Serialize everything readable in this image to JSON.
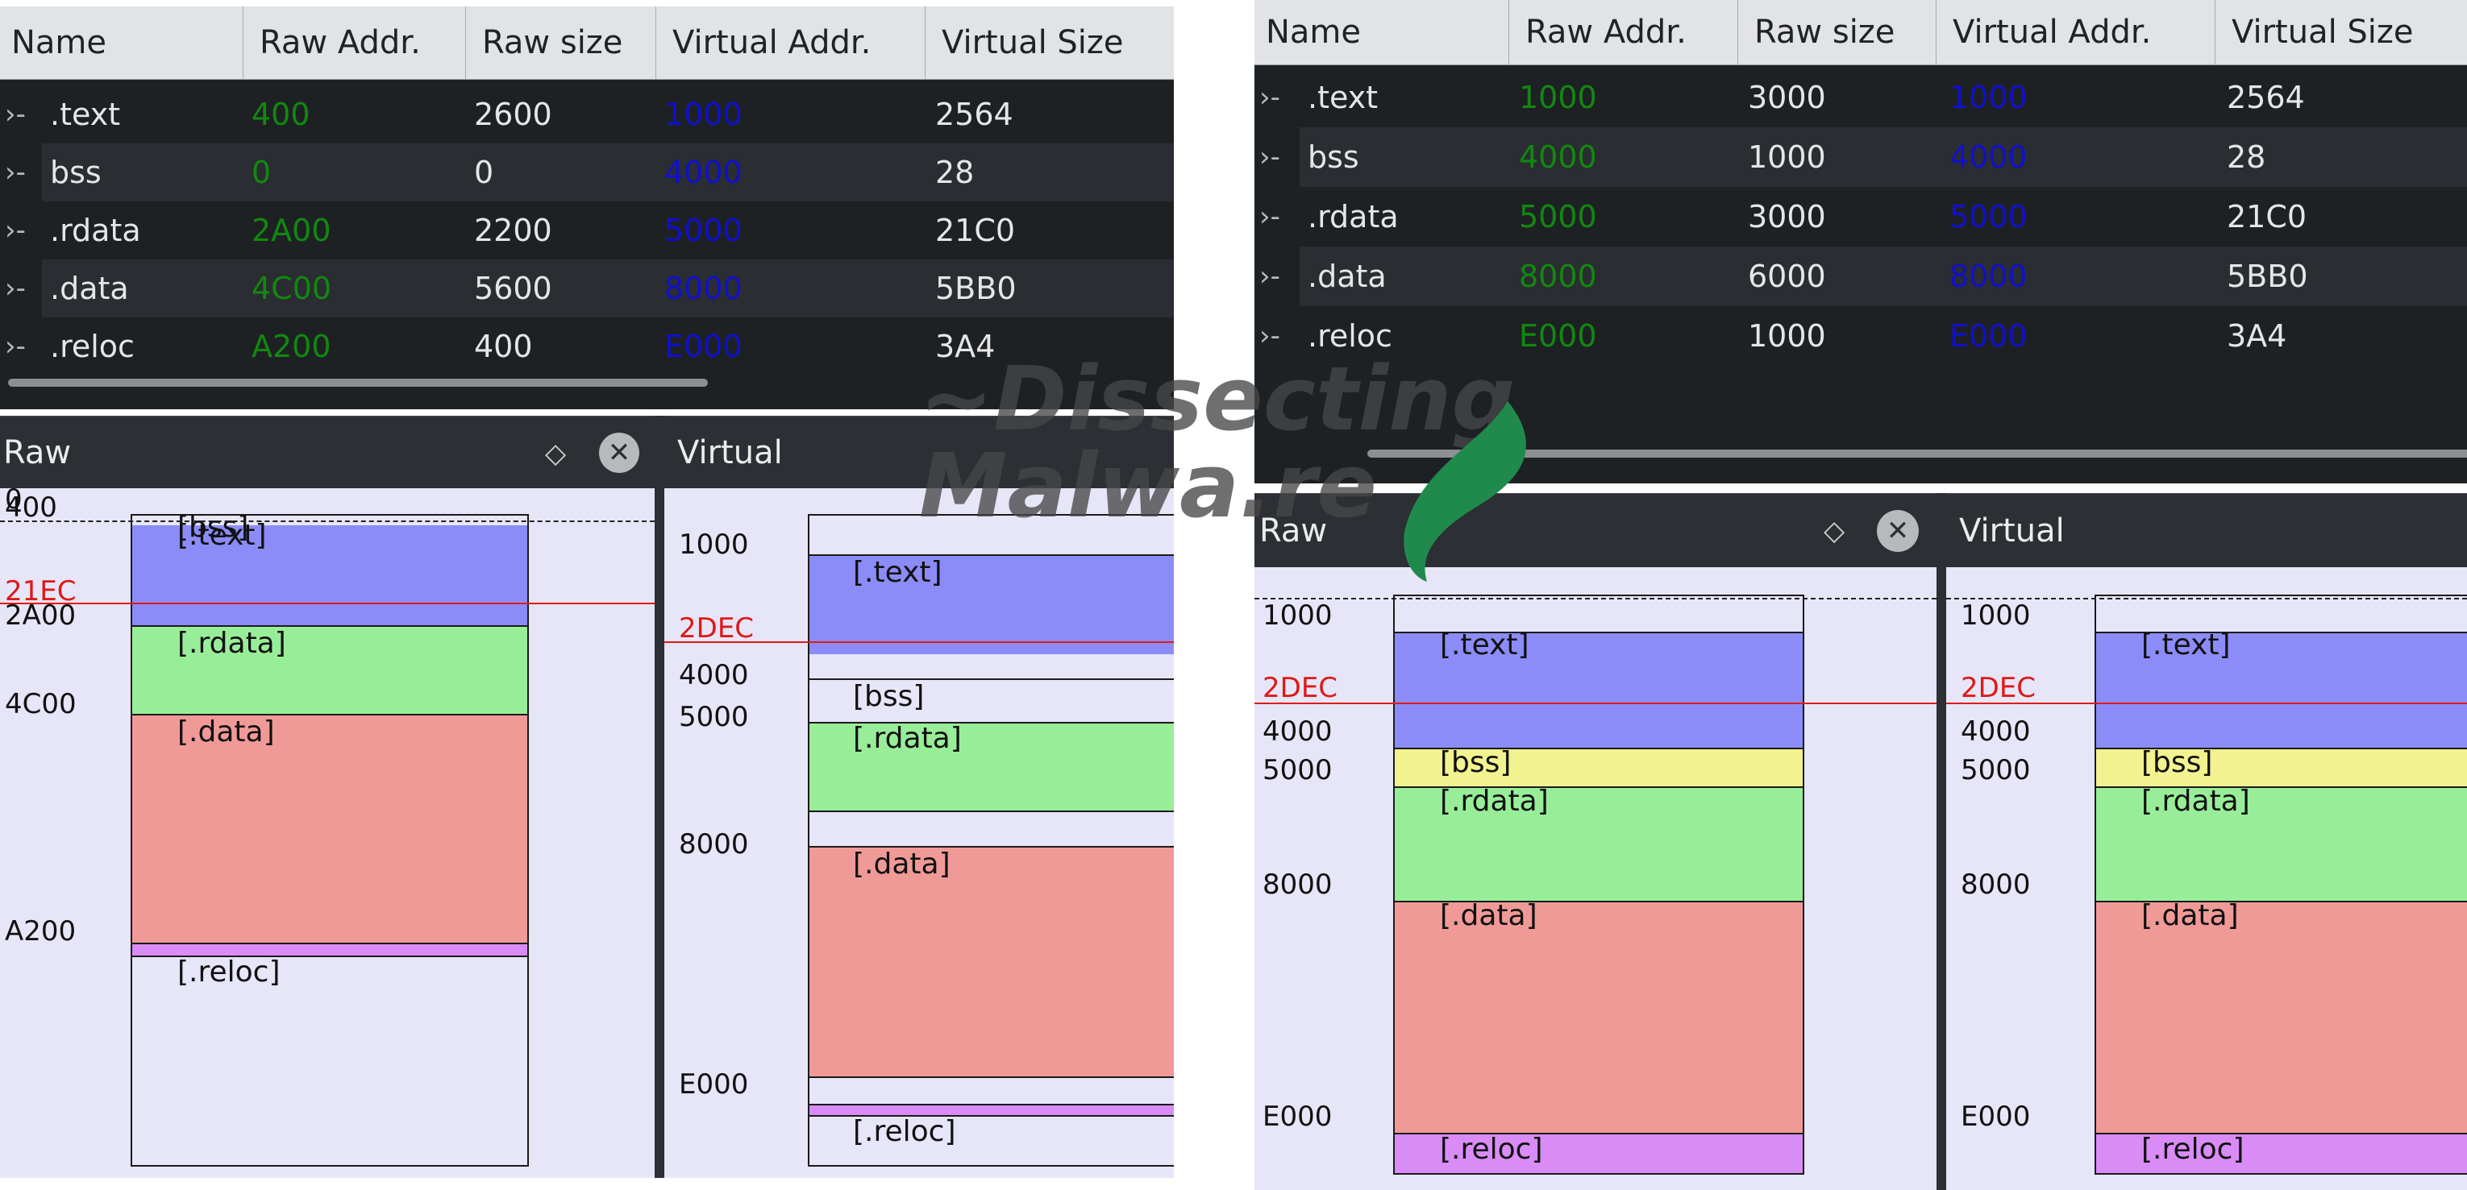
{
  "table": {
    "columns": [
      "Name",
      "Raw Addr.",
      "Raw size",
      "Virtual Addr.",
      "Virtual Size"
    ]
  },
  "left": {
    "rows": [
      {
        "name": ".text",
        "raw_addr": "400",
        "raw_size": "2600",
        "virt_addr": "1000",
        "virt_size": "2564"
      },
      {
        "name": "bss",
        "raw_addr": "0",
        "raw_size": "0",
        "virt_addr": "4000",
        "virt_size": "28"
      },
      {
        "name": ".rdata",
        "raw_addr": "2A00",
        "raw_size": "2200",
        "virt_addr": "5000",
        "virt_size": "21C0"
      },
      {
        "name": ".data",
        "raw_addr": "4C00",
        "raw_size": "5600",
        "virt_addr": "8000",
        "virt_size": "5BB0"
      },
      {
        "name": ".reloc",
        "raw_addr": "A200",
        "raw_size": "400",
        "virt_addr": "E000",
        "virt_size": "3A4"
      }
    ],
    "raw_title": "Raw",
    "virtual_title": "Virtual",
    "raw_labels": {
      "zero": "0",
      "a": "400",
      "cursor": "21EC",
      "b": "2A00",
      "c": "4C00",
      "d": "A200"
    },
    "raw_sections": {
      "bss": "[bss]",
      "text": "[.text]",
      "rdata": "[.rdata]",
      "data": "[.data]",
      "reloc": "[.reloc]"
    },
    "virt_labels": {
      "a": "1000",
      "cursor": "2DEC",
      "b": "4000",
      "c": "5000",
      "d": "8000",
      "e": "E000"
    },
    "virt_sections": {
      "text": "[.text]",
      "bss": "[bss]",
      "rdata": "[.rdata]",
      "data": "[.data]",
      "reloc": "[.reloc]"
    }
  },
  "right": {
    "rows": [
      {
        "name": ".text",
        "raw_addr": "1000",
        "raw_size": "3000",
        "virt_addr": "1000",
        "virt_size": "2564"
      },
      {
        "name": "bss",
        "raw_addr": "4000",
        "raw_size": "1000",
        "virt_addr": "4000",
        "virt_size": "28"
      },
      {
        "name": ".rdata",
        "raw_addr": "5000",
        "raw_size": "3000",
        "virt_addr": "5000",
        "virt_size": "21C0"
      },
      {
        "name": ".data",
        "raw_addr": "8000",
        "raw_size": "6000",
        "virt_addr": "8000",
        "virt_size": "5BB0"
      },
      {
        "name": ".reloc",
        "raw_addr": "E000",
        "raw_size": "1000",
        "virt_addr": "E000",
        "virt_size": "3A4"
      }
    ],
    "raw_title": "Raw",
    "virtual_title": "Virtual",
    "raw_labels": {
      "a": "1000",
      "cursor": "2DEC",
      "b": "4000",
      "c": "5000",
      "d": "8000",
      "e": "E000"
    },
    "raw_sections": {
      "text": "[.text]",
      "bss": "[bss]",
      "rdata": "[.rdata]",
      "data": "[.data]",
      "reloc": "[.reloc]"
    },
    "virt_labels": {
      "a": "1000",
      "cursor": "2DEC",
      "b": "4000",
      "c": "5000",
      "d": "8000",
      "e": "E000"
    },
    "virt_sections": {
      "text": "[.text]",
      "bss": "[bss]",
      "rdata": "[.rdata]",
      "data": "[.data]",
      "reloc": "[.reloc]"
    }
  },
  "watermark": {
    "line1": "~Dissecting",
    "line2": "Malwa.re"
  },
  "colors": {
    "text_section": "#8c8cf8",
    "bss_section": "#f2f290",
    "rdata_section": "#98ee98",
    "data_section": "#f09a98",
    "reloc_section": "#d98cf6",
    "raw_addr_text": "#11880f",
    "virtual_addr_text": "#1010cc",
    "cursor_line": "#e01818",
    "logo_green": "#1f8a4c"
  },
  "icons": [
    "expand-chevron-icon",
    "float-panel-icon",
    "close-panel-icon",
    "dissecting-malware-logo-icon"
  ]
}
